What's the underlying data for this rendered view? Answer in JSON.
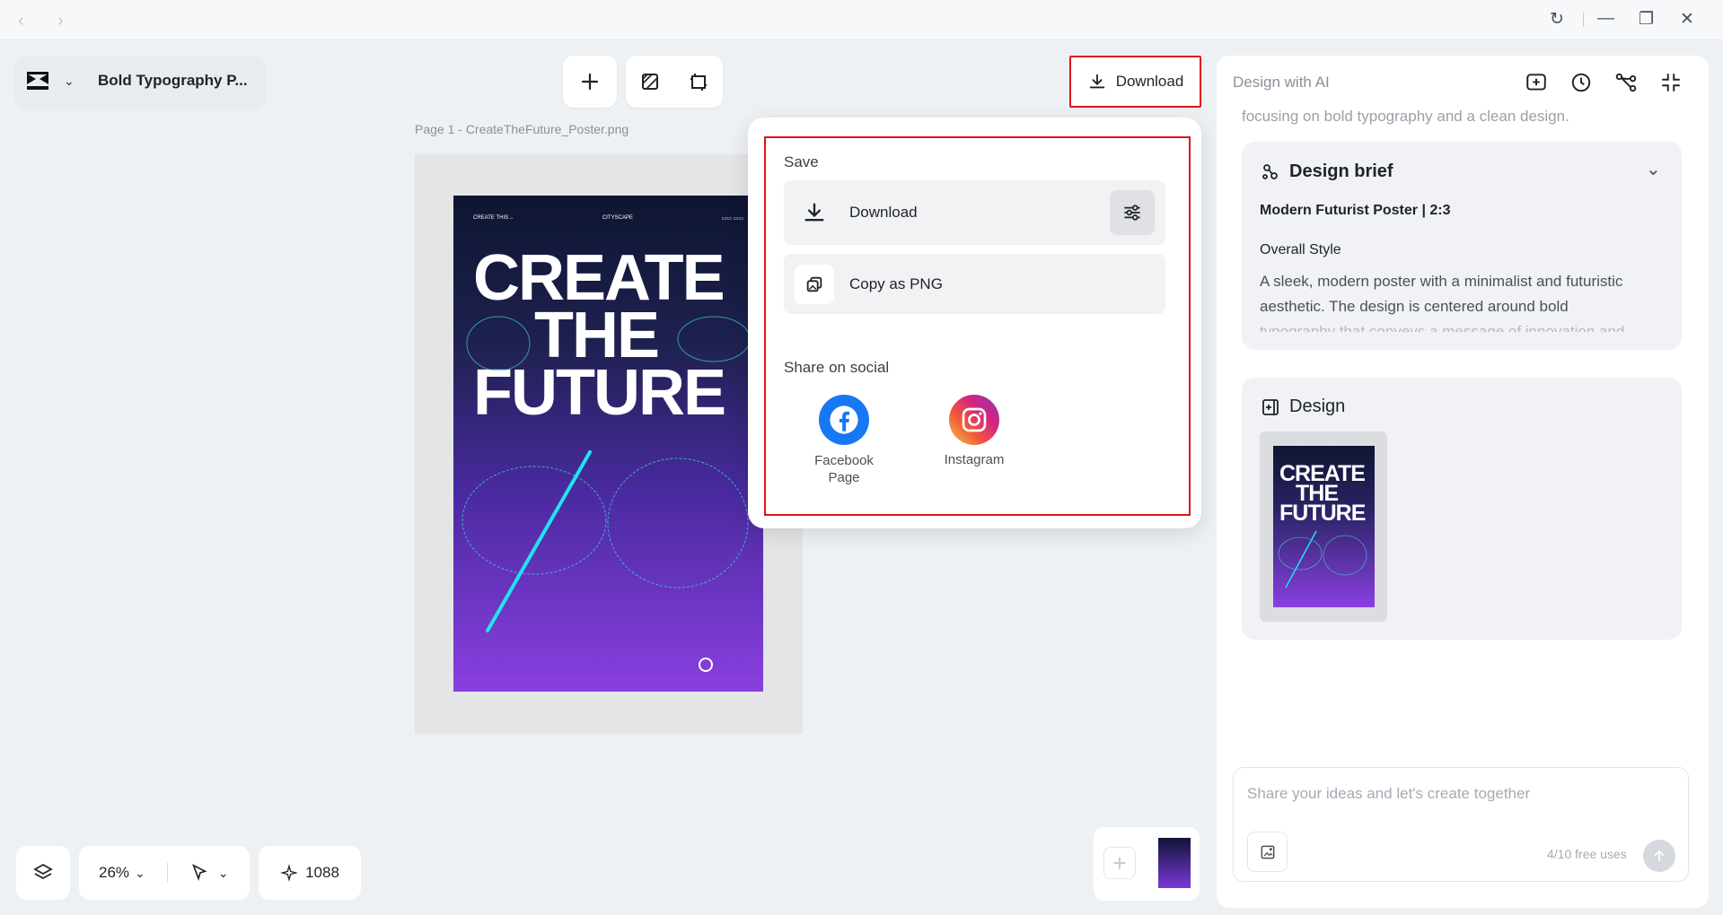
{
  "app": {
    "project_title": "Bold Typography P..."
  },
  "toolbar": {
    "download_label": "Download"
  },
  "canvas": {
    "page_label": "Page 1 -  CreateTheFuture_Poster.png",
    "poster": {
      "title_lines": [
        "CREATE",
        "THE",
        "FUTURE"
      ],
      "top_left": "CREATE THIS→",
      "top_center": "CITYSCAPE",
      "top_right": "▭▭ ▭▭"
    }
  },
  "popup": {
    "save_label": "Save",
    "download_option": "Download",
    "copy_option": "Copy as PNG",
    "share_label": "Share on social",
    "facebook_label": "Facebook\nPage",
    "instagram_label": "Instagram"
  },
  "ai_panel": {
    "title": "Design with AI",
    "fade_text": "focusing on bold typography and a clean design.",
    "brief": {
      "heading": "Design brief",
      "subtitle": "Modern Futurist Poster | 2:3",
      "style_heading": "Overall Style",
      "style_text": "A sleek, modern poster with a minimalist and futuristic aesthetic. The design is centered around bold",
      "style_text_cut": "typography that conveys a message of innovation and"
    },
    "design": {
      "heading": "Design",
      "thumb_lines": [
        "CREATE",
        "THE",
        "FUTURE"
      ]
    },
    "input_placeholder": "Share your ideas and let's create together",
    "free_uses": "4/10 free uses"
  },
  "bottom": {
    "zoom": "26%",
    "credits": "1088"
  },
  "colors": {
    "highlight": "#e0121a",
    "facebook": "#1877f2",
    "accent_cyan": "#22e3f0"
  }
}
